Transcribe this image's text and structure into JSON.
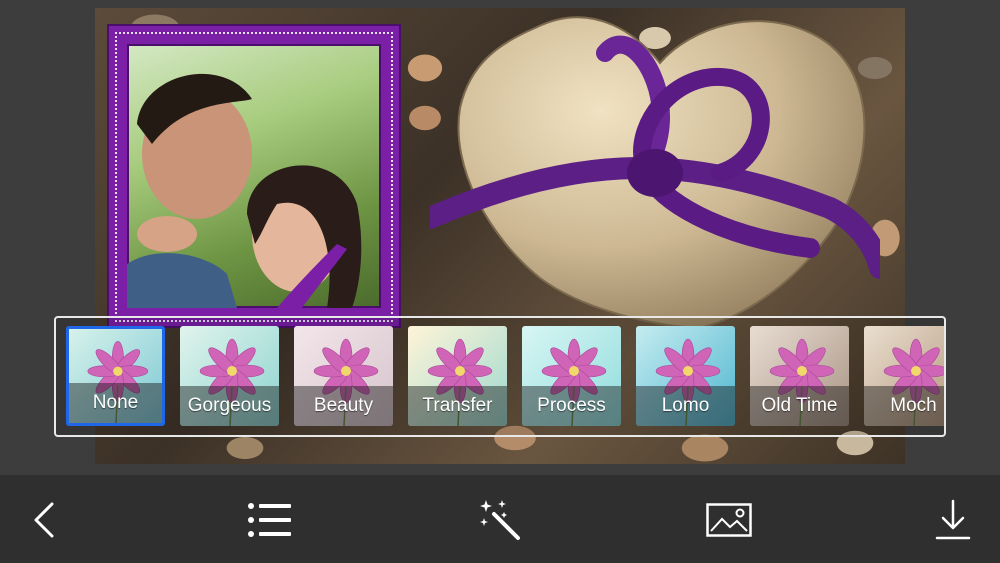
{
  "editor": {
    "filters": [
      {
        "label": "None",
        "selected": true,
        "tint": [
          "#d6f2ea",
          "#7ec8d6"
        ]
      },
      {
        "label": "Gorgeous",
        "selected": false,
        "tint": [
          "#e0f4ec",
          "#8dd3d0"
        ]
      },
      {
        "label": "Beauty",
        "selected": false,
        "tint": [
          "#f3e6ea",
          "#d5c3cb"
        ]
      },
      {
        "label": "Transfer",
        "selected": false,
        "tint": [
          "#fff4d8",
          "#9ed9cf"
        ]
      },
      {
        "label": "Process",
        "selected": false,
        "tint": [
          "#d8f6f4",
          "#8fdcdc"
        ]
      },
      {
        "label": "Lomo",
        "selected": false,
        "tint": [
          "#c5ecf0",
          "#4fb6cf"
        ]
      },
      {
        "label": "Old Time",
        "selected": false,
        "tint": [
          "#e8dcd2",
          "#a89484"
        ]
      },
      {
        "label": "Moch",
        "selected": false,
        "tint": [
          "#eadfcf",
          "#b09278"
        ]
      }
    ]
  },
  "toolbar": {
    "items": [
      {
        "icon": "back-chevron-icon"
      },
      {
        "icon": "list-icon"
      },
      {
        "icon": "magic-wand-icon"
      },
      {
        "icon": "image-icon"
      },
      {
        "icon": "download-icon"
      }
    ]
  },
  "colors": {
    "accent": "#1f66e8",
    "frame": "#7a1fa6",
    "toolbar_bg": "#2f2f2f",
    "app_bg": "#3d3d3d"
  }
}
